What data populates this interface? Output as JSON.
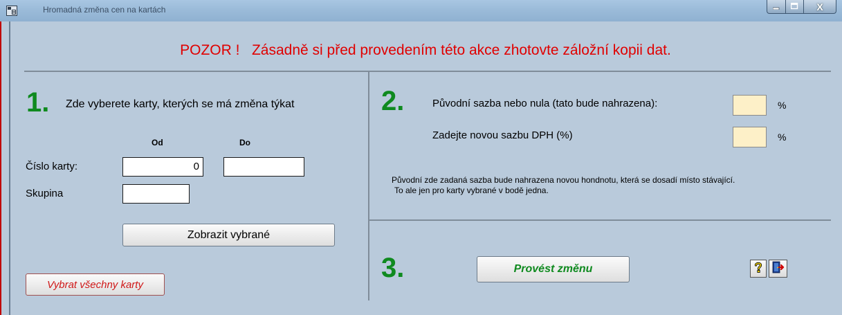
{
  "window": {
    "title": "Hromadná změna cen na kartách",
    "close_glyph": "X"
  },
  "warning": "POZOR !   Zásadně si před provedením této akce zhotovte záložní kopii dat.",
  "section1": {
    "number": "1.",
    "heading": "Zde vyberete karty, kterých se má změna týkat",
    "col_from": "Od",
    "col_to": "Do",
    "card_number_label": "Číslo karty:",
    "card_from_value": "0",
    "card_to_value": "",
    "group_label": "Skupina",
    "group_value": "",
    "show_selected_button": "Zobrazit vybrané",
    "select_all_button": "Vybrat všechny karty"
  },
  "section2": {
    "number": "2.",
    "original_rate_label": "Původní sazba nebo nula  (tato bude nahrazena):",
    "original_rate_value": "",
    "new_rate_label": "Zadejte novou sazbu DPH (%)",
    "new_rate_value": "",
    "percent_sign": "%",
    "note_line1": "Původní zde zadaná sazba bude nahrazena novou hondnotu, která se dosadí místo stávající.",
    "note_line2": "To ale jen pro karty vybrané v bodě jedna."
  },
  "section3": {
    "number": "3.",
    "execute_button": "Provést změnu"
  },
  "colors": {
    "accent_green": "#0f8a1f",
    "warning_red": "#e00000",
    "background": "#b9cadb"
  }
}
